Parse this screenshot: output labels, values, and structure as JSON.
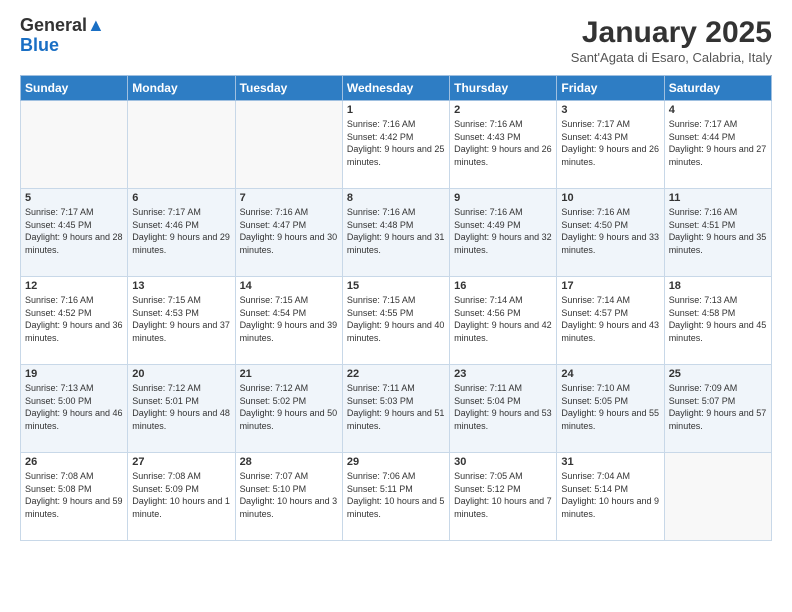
{
  "logo": {
    "line1": "General",
    "line2": "Blue"
  },
  "header": {
    "title": "January 2025",
    "subtitle": "Sant'Agata di Esaro, Calabria, Italy"
  },
  "days_of_week": [
    "Sunday",
    "Monday",
    "Tuesday",
    "Wednesday",
    "Thursday",
    "Friday",
    "Saturday"
  ],
  "weeks": [
    [
      {
        "day": "",
        "info": ""
      },
      {
        "day": "",
        "info": ""
      },
      {
        "day": "",
        "info": ""
      },
      {
        "day": "1",
        "info": "Sunrise: 7:16 AM\nSunset: 4:42 PM\nDaylight: 9 hours and 25 minutes."
      },
      {
        "day": "2",
        "info": "Sunrise: 7:16 AM\nSunset: 4:43 PM\nDaylight: 9 hours and 26 minutes."
      },
      {
        "day": "3",
        "info": "Sunrise: 7:17 AM\nSunset: 4:43 PM\nDaylight: 9 hours and 26 minutes."
      },
      {
        "day": "4",
        "info": "Sunrise: 7:17 AM\nSunset: 4:44 PM\nDaylight: 9 hours and 27 minutes."
      }
    ],
    [
      {
        "day": "5",
        "info": "Sunrise: 7:17 AM\nSunset: 4:45 PM\nDaylight: 9 hours and 28 minutes."
      },
      {
        "day": "6",
        "info": "Sunrise: 7:17 AM\nSunset: 4:46 PM\nDaylight: 9 hours and 29 minutes."
      },
      {
        "day": "7",
        "info": "Sunrise: 7:16 AM\nSunset: 4:47 PM\nDaylight: 9 hours and 30 minutes."
      },
      {
        "day": "8",
        "info": "Sunrise: 7:16 AM\nSunset: 4:48 PM\nDaylight: 9 hours and 31 minutes."
      },
      {
        "day": "9",
        "info": "Sunrise: 7:16 AM\nSunset: 4:49 PM\nDaylight: 9 hours and 32 minutes."
      },
      {
        "day": "10",
        "info": "Sunrise: 7:16 AM\nSunset: 4:50 PM\nDaylight: 9 hours and 33 minutes."
      },
      {
        "day": "11",
        "info": "Sunrise: 7:16 AM\nSunset: 4:51 PM\nDaylight: 9 hours and 35 minutes."
      }
    ],
    [
      {
        "day": "12",
        "info": "Sunrise: 7:16 AM\nSunset: 4:52 PM\nDaylight: 9 hours and 36 minutes."
      },
      {
        "day": "13",
        "info": "Sunrise: 7:15 AM\nSunset: 4:53 PM\nDaylight: 9 hours and 37 minutes."
      },
      {
        "day": "14",
        "info": "Sunrise: 7:15 AM\nSunset: 4:54 PM\nDaylight: 9 hours and 39 minutes."
      },
      {
        "day": "15",
        "info": "Sunrise: 7:15 AM\nSunset: 4:55 PM\nDaylight: 9 hours and 40 minutes."
      },
      {
        "day": "16",
        "info": "Sunrise: 7:14 AM\nSunset: 4:56 PM\nDaylight: 9 hours and 42 minutes."
      },
      {
        "day": "17",
        "info": "Sunrise: 7:14 AM\nSunset: 4:57 PM\nDaylight: 9 hours and 43 minutes."
      },
      {
        "day": "18",
        "info": "Sunrise: 7:13 AM\nSunset: 4:58 PM\nDaylight: 9 hours and 45 minutes."
      }
    ],
    [
      {
        "day": "19",
        "info": "Sunrise: 7:13 AM\nSunset: 5:00 PM\nDaylight: 9 hours and 46 minutes."
      },
      {
        "day": "20",
        "info": "Sunrise: 7:12 AM\nSunset: 5:01 PM\nDaylight: 9 hours and 48 minutes."
      },
      {
        "day": "21",
        "info": "Sunrise: 7:12 AM\nSunset: 5:02 PM\nDaylight: 9 hours and 50 minutes."
      },
      {
        "day": "22",
        "info": "Sunrise: 7:11 AM\nSunset: 5:03 PM\nDaylight: 9 hours and 51 minutes."
      },
      {
        "day": "23",
        "info": "Sunrise: 7:11 AM\nSunset: 5:04 PM\nDaylight: 9 hours and 53 minutes."
      },
      {
        "day": "24",
        "info": "Sunrise: 7:10 AM\nSunset: 5:05 PM\nDaylight: 9 hours and 55 minutes."
      },
      {
        "day": "25",
        "info": "Sunrise: 7:09 AM\nSunset: 5:07 PM\nDaylight: 9 hours and 57 minutes."
      }
    ],
    [
      {
        "day": "26",
        "info": "Sunrise: 7:08 AM\nSunset: 5:08 PM\nDaylight: 9 hours and 59 minutes."
      },
      {
        "day": "27",
        "info": "Sunrise: 7:08 AM\nSunset: 5:09 PM\nDaylight: 10 hours and 1 minute."
      },
      {
        "day": "28",
        "info": "Sunrise: 7:07 AM\nSunset: 5:10 PM\nDaylight: 10 hours and 3 minutes."
      },
      {
        "day": "29",
        "info": "Sunrise: 7:06 AM\nSunset: 5:11 PM\nDaylight: 10 hours and 5 minutes."
      },
      {
        "day": "30",
        "info": "Sunrise: 7:05 AM\nSunset: 5:12 PM\nDaylight: 10 hours and 7 minutes."
      },
      {
        "day": "31",
        "info": "Sunrise: 7:04 AM\nSunset: 5:14 PM\nDaylight: 10 hours and 9 minutes."
      },
      {
        "day": "",
        "info": ""
      }
    ]
  ]
}
